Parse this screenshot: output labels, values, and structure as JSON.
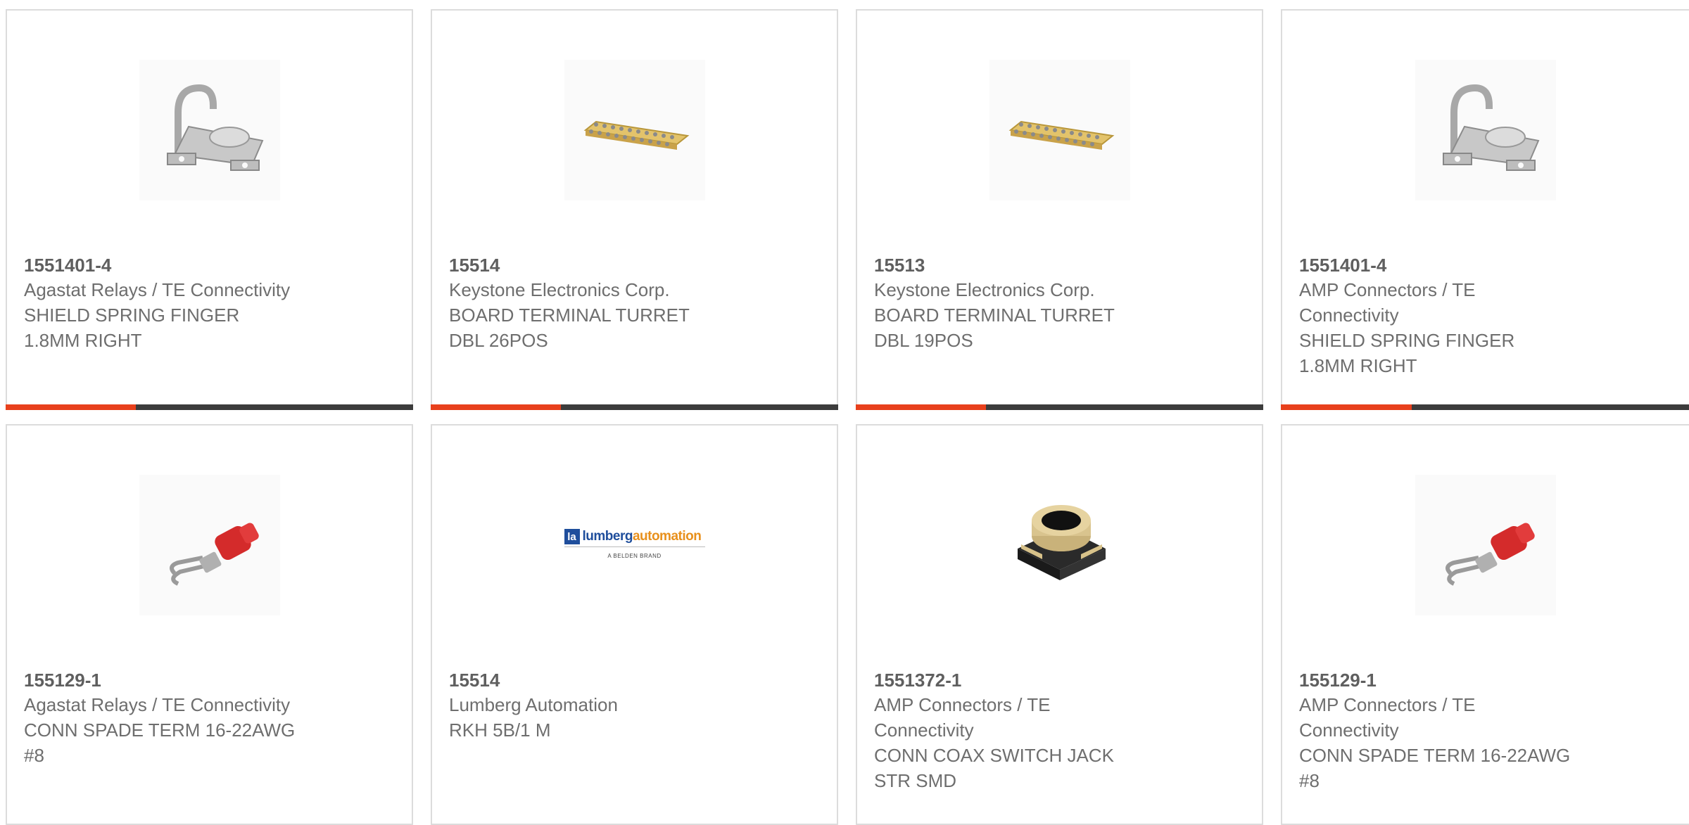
{
  "accent_color": "#e8401c",
  "bar_color": "#3c3c3c",
  "products": [
    {
      "part": "1551401-4",
      "manufacturer": "Agastat Relays / TE Connectivity",
      "description": "SHIELD SPRING FINGER\n1.8MM RIGHT",
      "image_icon": "spring-finger-icon"
    },
    {
      "part": "15514",
      "manufacturer": "Keystone Electronics Corp.",
      "description": "BOARD TERMINAL TURRET\nDBL 26POS",
      "image_icon": "terminal-strip-icon"
    },
    {
      "part": "15513",
      "manufacturer": "Keystone Electronics Corp.",
      "description": "BOARD TERMINAL TURRET\nDBL 19POS",
      "image_icon": "terminal-strip-icon"
    },
    {
      "part": "1551401-4",
      "manufacturer": "AMP Connectors / TE\nConnectivity",
      "description": "SHIELD SPRING FINGER\n1.8MM RIGHT",
      "image_icon": "spring-finger-icon"
    },
    {
      "part": "155129-1",
      "manufacturer": "Agastat Relays / TE Connectivity",
      "description": "CONN SPADE TERM 16-22AWG\n#8",
      "image_icon": "spade-terminal-icon"
    },
    {
      "part": "15514",
      "manufacturer": "Lumberg Automation",
      "description": "RKH 5B/1 M",
      "image_icon": "lumberg-logo",
      "logo_text_a": "lumberg",
      "logo_text_b": "automation",
      "logo_tagline": "A BELDEN BRAND"
    },
    {
      "part": "1551372-1",
      "manufacturer": "AMP Connectors / TE\nConnectivity",
      "description": "CONN COAX SWITCH JACK\nSTR SMD",
      "image_icon": "coax-jack-icon"
    },
    {
      "part": "155129-1",
      "manufacturer": "AMP Connectors / TE\nConnectivity",
      "description": "CONN SPADE TERM 16-22AWG\n#8",
      "image_icon": "spade-terminal-icon"
    }
  ]
}
